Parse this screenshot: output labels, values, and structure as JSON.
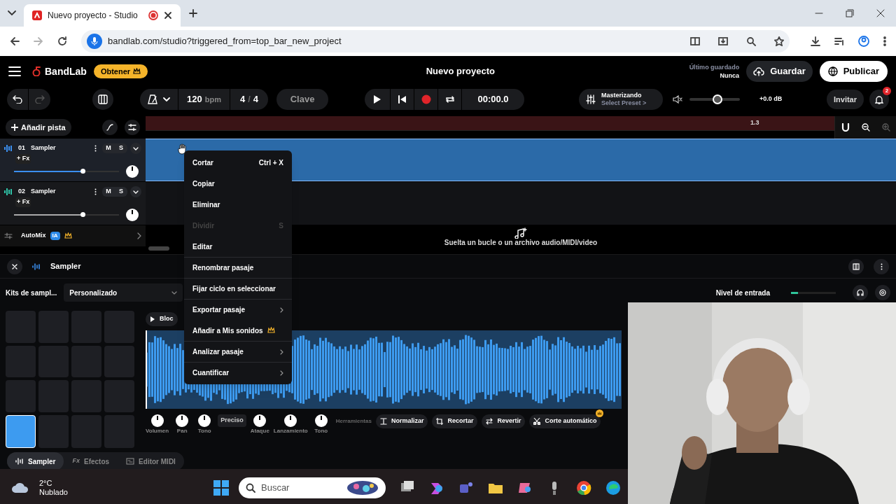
{
  "browser": {
    "tab": {
      "title": "Nuevo proyecto - Studio",
      "recording": true
    },
    "url": "bandlab.com/studio?triggered_from=top_bar_new_project"
  },
  "header": {
    "brand": "BandLab",
    "upgrade_button": "Obtener",
    "project_title": "Nuevo proyecto",
    "last_saved_label": "Último guardado",
    "last_saved_value": "Nunca",
    "save_button": "Guardar",
    "publish_button": "Publicar"
  },
  "toolbar": {
    "tempo": "120",
    "tempo_unit": "bpm",
    "time_signature": [
      "4",
      "/",
      "4"
    ],
    "key_button": "Clave",
    "time": "00:00.0",
    "mastering_title": "Masterizando",
    "mastering_preset": "Select Preset >",
    "volume": {
      "level": 0.55
    },
    "volume_reading": "+0.0 dB",
    "invite_button": "Invitar",
    "notifications": "2"
  },
  "timeline": {
    "add_track_button": "Añadir pista",
    "ruler_marker": "1.3"
  },
  "tracks": [
    {
      "number": "01",
      "name": "Sampler",
      "mute": "M",
      "solo": "S",
      "fx": "+ Fx",
      "volume": {
        "level": 0.65
      },
      "selected": true,
      "color": "#3b8ff0"
    },
    {
      "number": "02",
      "name": "Sampler",
      "mute": "M",
      "solo": "S",
      "fx": "+ Fx",
      "volume": {
        "level": 0.65
      },
      "selected": false,
      "color": "#2fc4a8"
    }
  ],
  "automix": {
    "label": "AutoMix",
    "badge": "IA"
  },
  "drop_zone": "Suelta un bucle o un archivo audio/MIDI/video",
  "context_menu": [
    {
      "label": "Cortar",
      "shortcut": "Ctrl + X",
      "disabled": false,
      "submenu": false,
      "premium": false,
      "separator": false
    },
    {
      "label": "Copiar",
      "disabled": false,
      "submenu": false,
      "premium": false,
      "separator": false
    },
    {
      "label": "Eliminar",
      "disabled": false,
      "submenu": false,
      "premium": false,
      "separator": false
    },
    {
      "label": "Dividir",
      "shortcut": "S",
      "disabled": true,
      "submenu": false,
      "premium": false,
      "separator": false
    },
    {
      "label": "Editar",
      "disabled": false,
      "submenu": false,
      "premium": false,
      "separator": false
    },
    {
      "label": "Renombrar pasaje",
      "disabled": false,
      "submenu": false,
      "premium": false,
      "separator": true
    },
    {
      "label": "Fijar ciclo en seleccionar",
      "disabled": false,
      "submenu": false,
      "premium": false,
      "separator": true
    },
    {
      "label": "Exportar pasaje",
      "disabled": false,
      "submenu": true,
      "premium": false,
      "separator": true
    },
    {
      "label": "Añadir a Mis sonidos",
      "disabled": false,
      "submenu": false,
      "premium": true,
      "separator": false
    },
    {
      "label": "Analizar pasaje",
      "disabled": false,
      "submenu": true,
      "premium": false,
      "separator": true
    },
    {
      "label": "Cuantificar",
      "disabled": false,
      "submenu": true,
      "premium": false,
      "separator": true
    }
  ],
  "sampler": {
    "title": "Sampler",
    "kits_label": "Kits de sampl...",
    "kit_value": "Personalizado",
    "input_level_label": "Nivel de entrada",
    "input_level": {
      "level": 0.15
    },
    "pads": [
      {
        "selected": false
      },
      {
        "selected": false
      },
      {
        "selected": false
      },
      {
        "selected": false
      },
      {
        "selected": false
      },
      {
        "selected": false
      },
      {
        "selected": false
      },
      {
        "selected": false
      },
      {
        "selected": false
      },
      {
        "selected": false
      },
      {
        "selected": false
      },
      {
        "selected": false
      },
      {
        "selected": true
      },
      {
        "selected": false
      },
      {
        "selected": false
      },
      {
        "selected": false
      }
    ],
    "play_button": "Bloc",
    "controls": [
      {
        "kind": "knob",
        "label": "Volumen"
      },
      {
        "kind": "knob",
        "label": "Pan"
      },
      {
        "kind": "knob",
        "label": "Tono"
      },
      {
        "kind": "toggle",
        "label": "Preciso"
      },
      {
        "kind": "knob",
        "label": "Ataque"
      },
      {
        "kind": "knob",
        "label": "Lanzamiento"
      },
      {
        "kind": "knob",
        "label": "Tono"
      }
    ],
    "tools_label": "Herramientas",
    "tools": [
      {
        "label": "Normalizar",
        "premium": false
      },
      {
        "label": "Recortar",
        "premium": false
      },
      {
        "label": "Revertir",
        "premium": false
      },
      {
        "label": "Corte automático",
        "premium": true
      }
    ],
    "tabs": [
      {
        "label": "Sampler",
        "selected": true
      },
      {
        "label": "Efectos",
        "icon_text": "Fx",
        "selected": false
      },
      {
        "label": "Editor MIDI",
        "selected": false
      }
    ]
  },
  "taskbar": {
    "temperature": "2°C",
    "weather": "Nublado",
    "search_placeholder": "Buscar"
  }
}
